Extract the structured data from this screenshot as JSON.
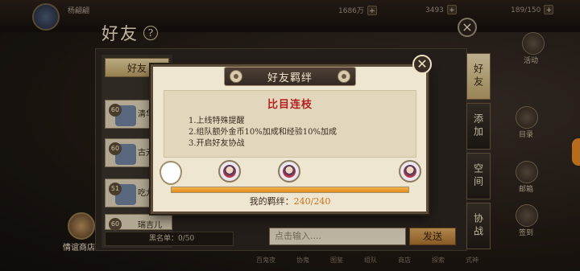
{
  "background": {
    "player_name": "杨翩翩",
    "resources": [
      {
        "value": "1686万"
      },
      {
        "value": "3493"
      },
      {
        "value": "189/150"
      }
    ],
    "page_title": "好友",
    "left_tab_label": "好友",
    "friends": [
      {
        "level": "60",
        "name": "清华"
      },
      {
        "level": "60",
        "name": "古元"
      },
      {
        "level": "51",
        "name": "吃九"
      },
      {
        "level": "60",
        "name": "瑞吉儿"
      }
    ],
    "blacklist_text": "黑名单：0/50",
    "shop_label": "情谊商店",
    "chat_placeholder": "点击输入....",
    "send_label": "发送",
    "right_tabs": [
      "好友",
      "添加",
      "空间",
      "协战"
    ],
    "right_icons": [
      "活动",
      "目录",
      "邮箱",
      "签到"
    ],
    "bottom_menu": [
      "百鬼夜",
      "协鬼",
      "图鉴",
      "组队",
      "商店",
      "探索",
      "式神"
    ]
  },
  "modal": {
    "title": "好友羁绊",
    "heading": "比目连枝",
    "benefits": [
      "1.上线特殊提醒",
      "2.组队额外金币10%加成和经验10%加成",
      "3.开启好友协战"
    ],
    "bond_label": "我的羁绊：",
    "bond_value": "240/240",
    "progress_fraction": 1.0,
    "close_glyph": "✕"
  },
  "colors": {
    "heading_red": "#b31e1e",
    "progress_orange": "#e08a1c",
    "bond_value": "#c6721e"
  }
}
